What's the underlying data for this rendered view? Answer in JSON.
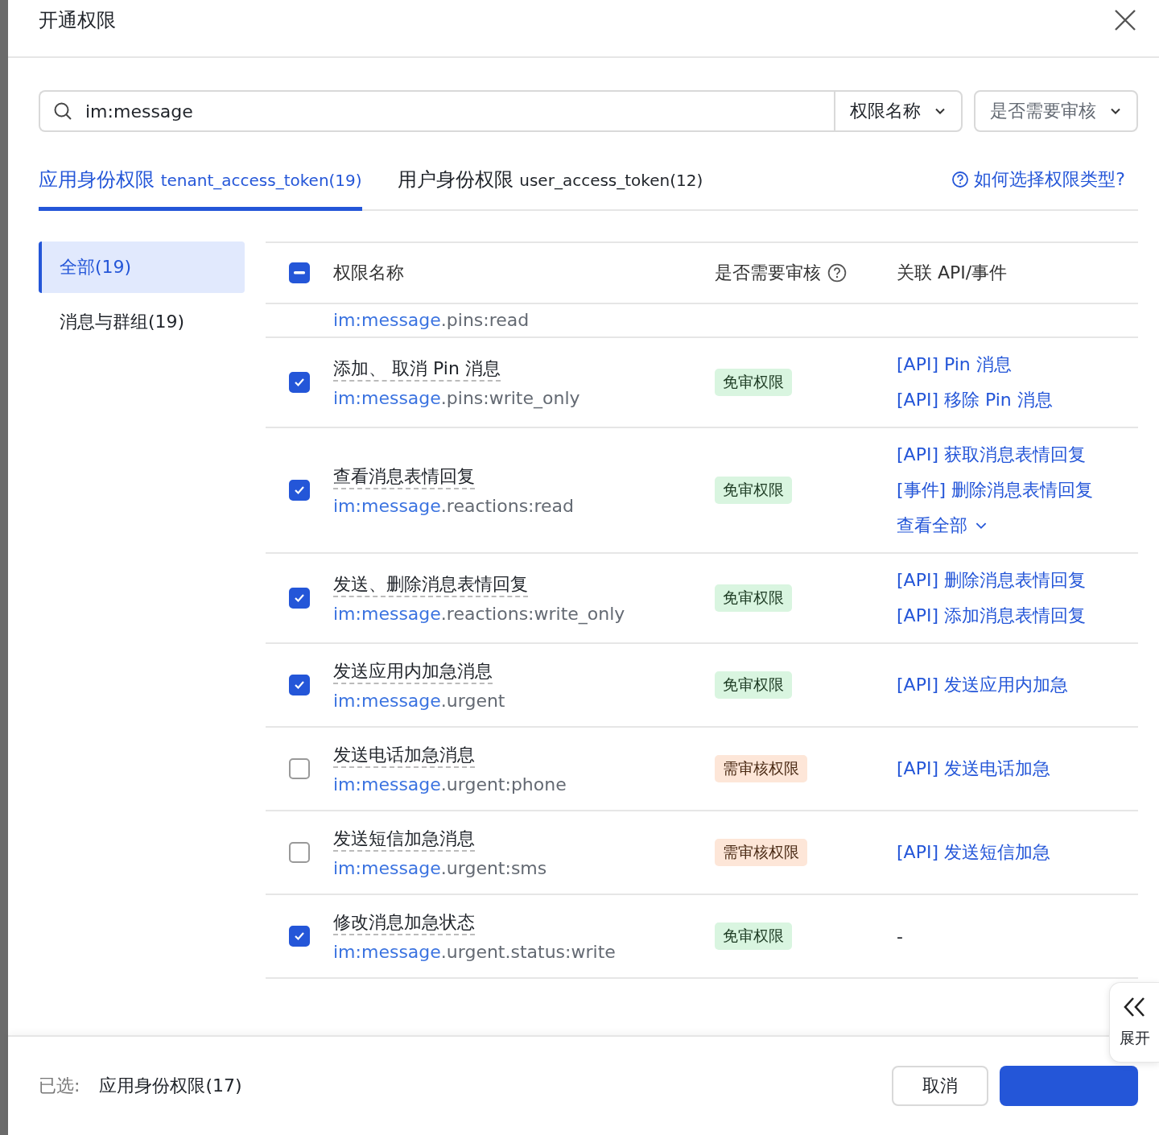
{
  "dialog": {
    "title": "开通权限"
  },
  "search": {
    "value": "im:message",
    "field_select": "权限名称",
    "review_select": "是否需要审核"
  },
  "tabs": [
    {
      "label": "应用身份权限",
      "token": "tenant_access_token(19)",
      "selected": true
    },
    {
      "label": "用户身份权限",
      "token": "user_access_token(12)",
      "selected": false
    }
  ],
  "help_link": "如何选择权限类型?",
  "sidebar": {
    "items": [
      {
        "label": "全部(19)",
        "selected": true
      },
      {
        "label": "消息与群组(19)",
        "selected": false
      }
    ]
  },
  "table": {
    "select_all": {
      "indeterminate": true
    },
    "columns": [
      "权限名称",
      "是否需要审核",
      "关联 API/事件"
    ],
    "partial_row": {
      "scope_match": "im:message",
      "scope_rest": ".pins:read"
    },
    "rows": [
      {
        "checked": true,
        "name": "添加、 取消 Pin 消息",
        "scope_match": "im:message",
        "scope_rest": ".pins:write_only",
        "tag": {
          "kind": "free",
          "label": "免审权限"
        },
        "apis": [
          "[API] Pin 消息",
          "[API] 移除 Pin 消息"
        ]
      },
      {
        "checked": true,
        "name": "查看消息表情回复",
        "scope_match": "im:message",
        "scope_rest": ".reactions:read",
        "tag": {
          "kind": "free",
          "label": "免审权限"
        },
        "apis": [
          "[API] 获取消息表情回复",
          "[事件] 删除消息表情回复"
        ],
        "more": "查看全部"
      },
      {
        "checked": true,
        "name": "发送、删除消息表情回复",
        "scope_match": "im:message",
        "scope_rest": ".reactions:write_only",
        "tag": {
          "kind": "free",
          "label": "免审权限"
        },
        "apis": [
          "[API] 删除消息表情回复",
          "[API] 添加消息表情回复"
        ]
      },
      {
        "checked": true,
        "name": "发送应用内加急消息",
        "scope_match": "im:message",
        "scope_rest": ".urgent",
        "tag": {
          "kind": "free",
          "label": "免审权限"
        },
        "apis": [
          "[API] 发送应用内加急"
        ]
      },
      {
        "checked": false,
        "name": "发送电话加急消息",
        "scope_match": "im:message",
        "scope_rest": ".urgent:phone",
        "tag": {
          "kind": "review",
          "label": "需审核权限"
        },
        "apis": [
          "[API] 发送电话加急"
        ]
      },
      {
        "checked": false,
        "name": "发送短信加急消息",
        "scope_match": "im:message",
        "scope_rest": ".urgent:sms",
        "tag": {
          "kind": "review",
          "label": "需审核权限"
        },
        "apis": [
          "[API] 发送短信加急"
        ]
      },
      {
        "checked": true,
        "name": "修改消息加急状态",
        "scope_match": "im:message",
        "scope_rest": ".urgent.status:write",
        "tag": {
          "kind": "free",
          "label": "免审权限"
        },
        "apis": [],
        "empty": "-"
      }
    ]
  },
  "side_tab": {
    "label": "展开"
  },
  "footer": {
    "selected_label": "已选:",
    "selected_value": "应用身份权限(17)",
    "cancel": "取消"
  }
}
